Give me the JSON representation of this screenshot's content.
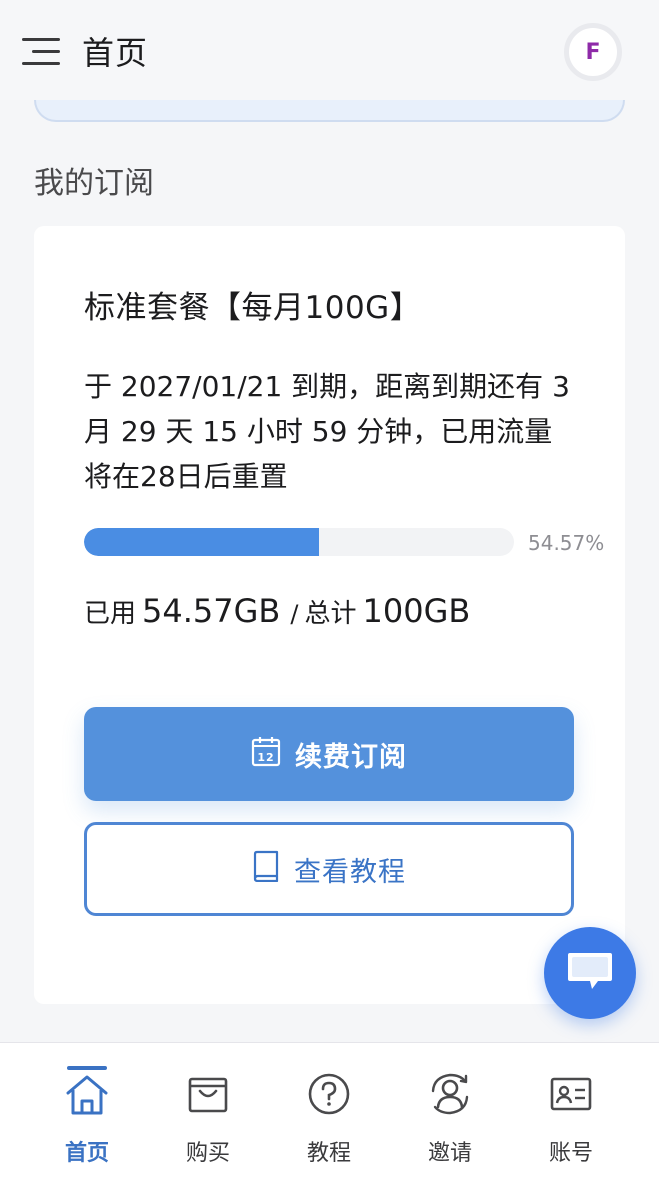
{
  "header": {
    "title": "首页",
    "avatar_letter": "F"
  },
  "section": {
    "title": "我的订阅"
  },
  "subscription": {
    "plan_name": "标准套餐【每月100G】",
    "expire_text": "于 2027/01/21 到期，距离到期还有 3 月 29 天 15 小时 59 分钟，已用流量将在28日后重置",
    "progress_percent": 54.57,
    "progress_label": "54.57%",
    "used_label": "已用",
    "used_value": "54.57GB",
    "separator": "/",
    "total_label": "总计",
    "total_value": "100GB",
    "accent_color": "#4a8de3"
  },
  "actions": {
    "renew_label": "续费订阅",
    "renew_icon": "calendar-icon",
    "tutorial_label": "查看教程",
    "tutorial_icon": "book-icon"
  },
  "chat": {
    "icon": "chat-bubble-icon"
  },
  "bottom_nav": {
    "items": [
      {
        "label": "首页",
        "icon": "home-icon",
        "active": true
      },
      {
        "label": "购买",
        "icon": "shopping-bag-icon",
        "active": false
      },
      {
        "label": "教程",
        "icon": "help-circle-icon",
        "active": false
      },
      {
        "label": "邀请",
        "icon": "invite-user-icon",
        "active": false
      },
      {
        "label": "账号",
        "icon": "id-card-icon",
        "active": false
      }
    ]
  }
}
